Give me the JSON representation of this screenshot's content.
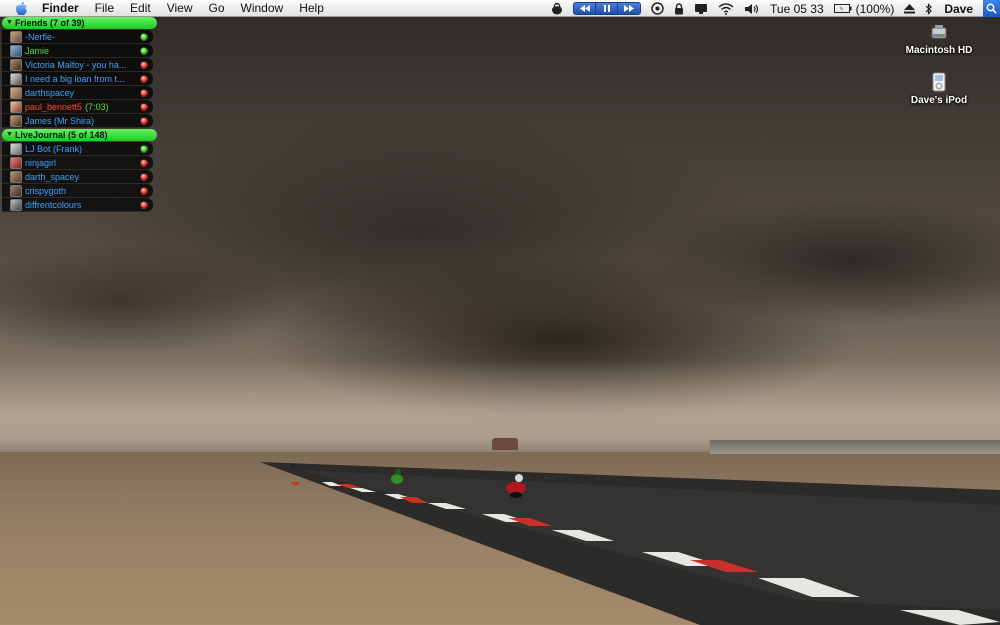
{
  "menubar": {
    "app_name": "Finder",
    "menus": [
      "File",
      "Edit",
      "View",
      "Go",
      "Window",
      "Help"
    ],
    "clock": "Tue 05 33",
    "battery": "(100%)",
    "user": "Dave"
  },
  "buddy_list": {
    "groups": [
      {
        "header": "Friends (7 of 39)",
        "buddies": [
          {
            "name": "-Nerfie-",
            "idle": "",
            "status": "available",
            "color": "#3fa0ff"
          },
          {
            "name": "Jamie",
            "idle": "",
            "status": "available",
            "color": "#4edc3c"
          },
          {
            "name": "Victoria Malfoy - you ha...",
            "idle": "",
            "status": "away",
            "color": "#3fa0ff"
          },
          {
            "name": "I need a big loan from t...",
            "idle": "",
            "status": "away",
            "color": "#3fa0ff"
          },
          {
            "name": "darthspacey",
            "idle": "",
            "status": "away",
            "color": "#3fa0ff"
          },
          {
            "name": "paul_bennett5",
            "idle": "(7:03)",
            "status": "away",
            "color": "#ff4a36"
          },
          {
            "name": "James (Mr Shira)",
            "idle": "",
            "status": "away",
            "color": "#3fa0ff"
          }
        ]
      },
      {
        "header": "LiveJournal (5 of 148)",
        "buddies": [
          {
            "name": "LJ Bot (Frank)",
            "idle": "",
            "status": "available",
            "color": "#3fa0ff"
          },
          {
            "name": "ninjagirl",
            "idle": "",
            "status": "away",
            "color": "#3fa0ff"
          },
          {
            "name": "darth_spacey",
            "idle": "",
            "status": "away",
            "color": "#3fa0ff"
          },
          {
            "name": "crispygoth",
            "idle": "",
            "status": "away",
            "color": "#3fa0ff"
          },
          {
            "name": "diffrentcolours",
            "idle": "",
            "status": "away",
            "color": "#3fa0ff"
          }
        ]
      }
    ]
  },
  "desktop_icons": [
    {
      "label": "Macintosh HD",
      "icon": "hard-drive-icon"
    },
    {
      "label": "Dave's iPod",
      "icon": "ipod-icon"
    }
  ],
  "colors": {
    "status_available": "#3fcf2a",
    "status_away": "#e8312c",
    "group_header": "#22c822",
    "spotlight": "#1b58c4"
  }
}
